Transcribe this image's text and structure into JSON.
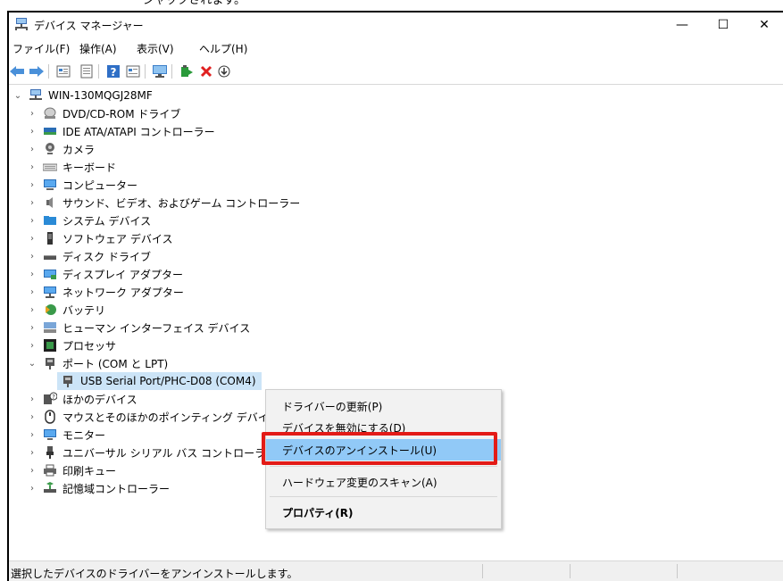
{
  "top_caption": "ジャックされます。",
  "window": {
    "title": "デバイス マネージャー",
    "minimize_glyph": "—",
    "maximize_glyph": "☐",
    "close_glyph": "✕"
  },
  "menu": [
    "ファイル(F)",
    "操作(A)",
    "表示(V)",
    "ヘルプ(H)"
  ],
  "toolbar": [
    "back-icon",
    "forward-icon",
    "properties-icon",
    "view-icon",
    "help-icon",
    "update-view-icon",
    "monitor-icon",
    "update-driver-icon",
    "uninstall-icon",
    "download-icon"
  ],
  "tree": {
    "root": "WIN-130MQGJ28MF",
    "items": [
      {
        "label": "DVD/CD-ROM ドライブ",
        "icon": "dvd-drive-icon"
      },
      {
        "label": "IDE ATA/ATAPI コントローラー",
        "icon": "ide-controller-icon"
      },
      {
        "label": "カメラ",
        "icon": "camera-icon"
      },
      {
        "label": "キーボード",
        "icon": "keyboard-icon"
      },
      {
        "label": "コンピューター",
        "icon": "computer-icon"
      },
      {
        "label": "サウンド、ビデオ、およびゲーム コントローラー",
        "icon": "speaker-icon"
      },
      {
        "label": "システム デバイス",
        "icon": "system-devices-icon"
      },
      {
        "label": "ソフトウェア デバイス",
        "icon": "software-device-icon"
      },
      {
        "label": "ディスク ドライブ",
        "icon": "disk-drive-icon"
      },
      {
        "label": "ディスプレイ アダプター",
        "icon": "display-adapter-icon"
      },
      {
        "label": "ネットワーク アダプター",
        "icon": "network-adapter-icon"
      },
      {
        "label": "バッテリ",
        "icon": "battery-icon"
      },
      {
        "label": "ヒューマン インターフェイス デバイス",
        "icon": "hid-icon"
      },
      {
        "label": "プロセッサ",
        "icon": "processor-icon"
      },
      {
        "label": "ポート (COM と LPT)",
        "icon": "port-icon"
      },
      {
        "label": "USB Serial Port/PHC-D08 (COM4)",
        "icon": "serial-port-icon"
      },
      {
        "label": "ほかのデバイス",
        "icon": "other-devices-icon"
      },
      {
        "label": "マウスとそのほかのポインティング デバイス",
        "icon": "mouse-icon"
      },
      {
        "label": "モニター",
        "icon": "monitor-icon"
      },
      {
        "label": "ユニバーサル シリアル バス コントローラー",
        "icon": "usb-icon"
      },
      {
        "label": "印刷キュー",
        "icon": "print-queue-icon"
      },
      {
        "label": "記憶域コントローラー",
        "icon": "storage-controller-icon"
      }
    ]
  },
  "context_menu": {
    "update_driver": "ドライバーの更新(P)",
    "disable_device": "デバイスを無効にする(D)",
    "uninstall_device": "デバイスのアンインストール(U)",
    "scan_hardware": "ハードウェア変更のスキャン(A)",
    "properties": "プロパティ(R)"
  },
  "status": "選択したデバイスのドライバーをアンインストールします。",
  "colors": {
    "selection": "#cce4f7",
    "menu_highlight": "#91c9f7",
    "callout": "#e31b17",
    "uninstall_red": "#e02020"
  }
}
